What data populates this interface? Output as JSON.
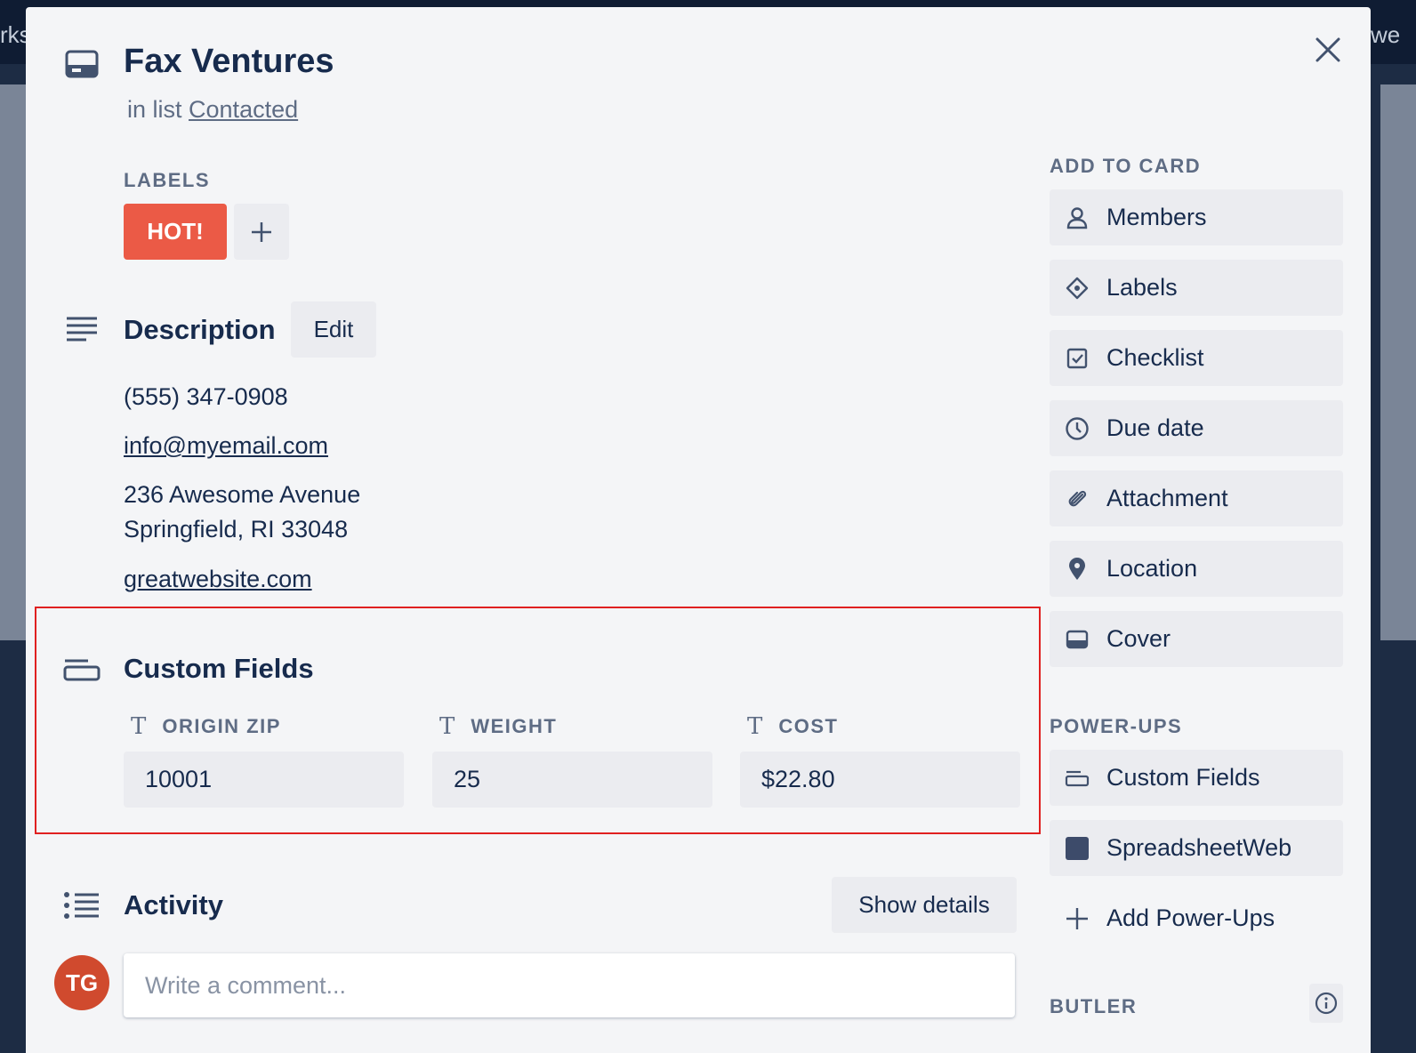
{
  "card": {
    "title": "Fax Ventures",
    "in_list_prefix": "in list",
    "list_name": "Contacted"
  },
  "labels": {
    "heading": "LABELS",
    "items": [
      {
        "text": "HOT!",
        "color": "#eb5a46"
      }
    ]
  },
  "description": {
    "heading": "Description",
    "edit_label": "Edit",
    "phone": "(555) 347-0908",
    "email": "info@myemail.com",
    "address_line1": "236 Awesome Avenue",
    "address_line2": "Springfield, RI 33048",
    "website": "greatwebsite.com"
  },
  "custom_fields": {
    "heading": "Custom Fields",
    "fields": [
      {
        "label": "ORIGIN ZIP",
        "value": "10001"
      },
      {
        "label": "WEIGHT",
        "value": "25"
      },
      {
        "label": "COST",
        "value": "$22.80"
      }
    ]
  },
  "activity": {
    "heading": "Activity",
    "show_details_label": "Show details",
    "avatar_initials": "TG",
    "comment_placeholder": "Write a comment..."
  },
  "sidebar": {
    "add_to_card_heading": "ADD TO CARD",
    "add_to_card": [
      {
        "label": "Members",
        "icon": "person-icon"
      },
      {
        "label": "Labels",
        "icon": "tag-icon"
      },
      {
        "label": "Checklist",
        "icon": "checkbox-icon"
      },
      {
        "label": "Due date",
        "icon": "clock-icon"
      },
      {
        "label": "Attachment",
        "icon": "paperclip-icon"
      },
      {
        "label": "Location",
        "icon": "pin-icon"
      },
      {
        "label": "Cover",
        "icon": "cover-icon"
      }
    ],
    "powerups_heading": "POWER-UPS",
    "powerups": [
      {
        "label": "Custom Fields",
        "icon": "custom-fields-icon"
      },
      {
        "label": "SpreadsheetWeb",
        "icon": "spreadsheetweb-icon"
      },
      {
        "label": "Add Power-Ups",
        "icon": "plus-icon"
      }
    ],
    "butler_heading": "BUTLER"
  },
  "background": {
    "left_fragment": "rks",
    "right_fragment": "we"
  },
  "colors": {
    "label_red": "#eb5a46",
    "modal_bg": "#f4f5f7",
    "button_bg": "#ebecf0",
    "text_dark": "#172b4d",
    "text_muted": "#5e6c84",
    "avatar": "#d04a2e",
    "highlight_border": "#e02020"
  }
}
